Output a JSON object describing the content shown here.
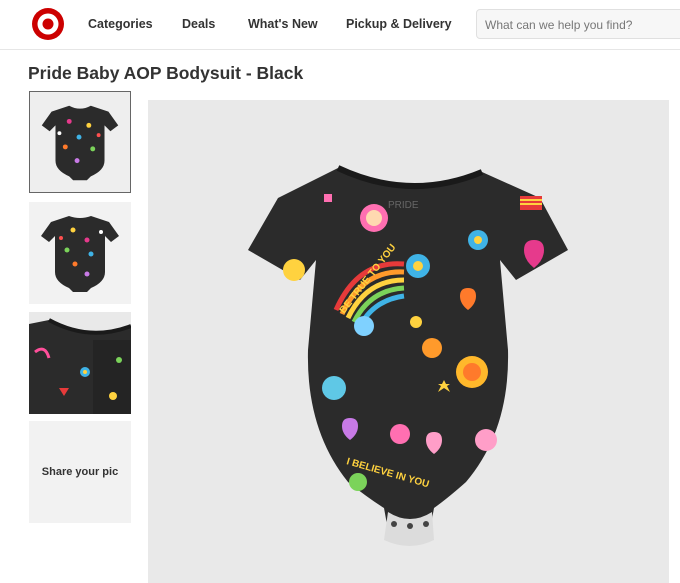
{
  "header": {
    "logo_icon": "target-bullseye-icon",
    "brand_color": "#cc0000",
    "nav": [
      {
        "label": "Categories"
      },
      {
        "label": "Deals"
      },
      {
        "label": "What's New"
      },
      {
        "label": "Pickup & Delivery"
      }
    ],
    "search": {
      "placeholder": "What can we help you find?"
    }
  },
  "product": {
    "title": "Pride Baby AOP Bodysuit - Black",
    "thumbnails": [
      {
        "view": "front",
        "selected": true
      },
      {
        "view": "back",
        "selected": false
      },
      {
        "view": "detail",
        "selected": false
      }
    ],
    "share_label": "Share your pic",
    "garment_color": "#2b2b2b",
    "print_text": {
      "slogan_1": "BE TRUE TO YOU",
      "slogan_2": "I BELIEVE IN YOU",
      "neck_label": "PRIDE"
    }
  }
}
